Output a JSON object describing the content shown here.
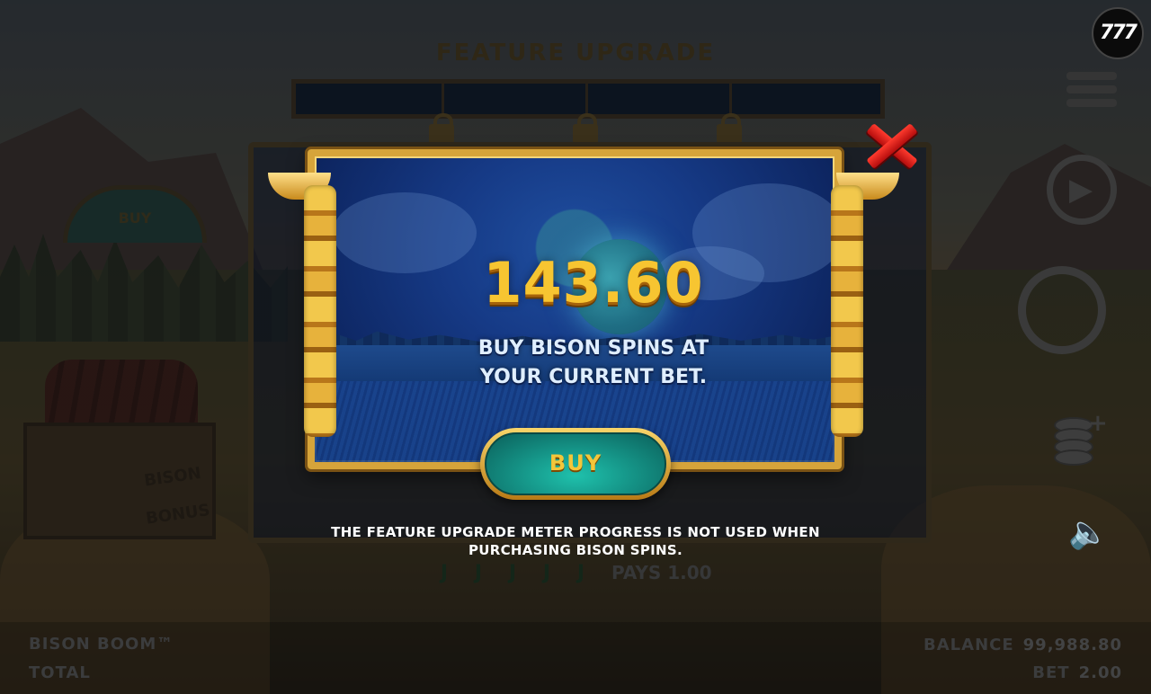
{
  "background": {
    "section_title": "FEATURE UPGRADE",
    "side_buy_label": "BUY",
    "crate_label_1": "BISON",
    "crate_label_2": "BONUS",
    "pays_symbols": [
      "J",
      "J",
      "J",
      "J",
      "J"
    ],
    "pays_text": "PAYS 1.00",
    "game_name": "BISON BOOM™",
    "total_label": "TOTAL",
    "balance_label": "BALANCE",
    "balance_value": "99,988.80",
    "bet_label": "BET",
    "bet_value": "2.00"
  },
  "controls": {
    "logo_text": "777",
    "menu_icon": "hamburger-menu-icon",
    "autoplay_icon": "autoplay-icon",
    "spin_icon": "spin-icon",
    "bet_settings_icon": "coins-plus-icon",
    "sound_icon": "speaker-icon"
  },
  "dialog": {
    "amount": "143.60",
    "description_line1": "BUY BISON SPINS AT",
    "description_line2": "YOUR CURRENT BET.",
    "buy_label": "BUY",
    "close_icon": "close-x-icon",
    "note_line1": "THE FEATURE UPGRADE METER PROGRESS IS NOT USED WHEN",
    "note_line2": "PURCHASING BISON SPINS."
  },
  "colors": {
    "gold": "#f7c531",
    "button_teal": "#159487",
    "close_red": "#e02020",
    "panel_blue": "#163a86"
  }
}
